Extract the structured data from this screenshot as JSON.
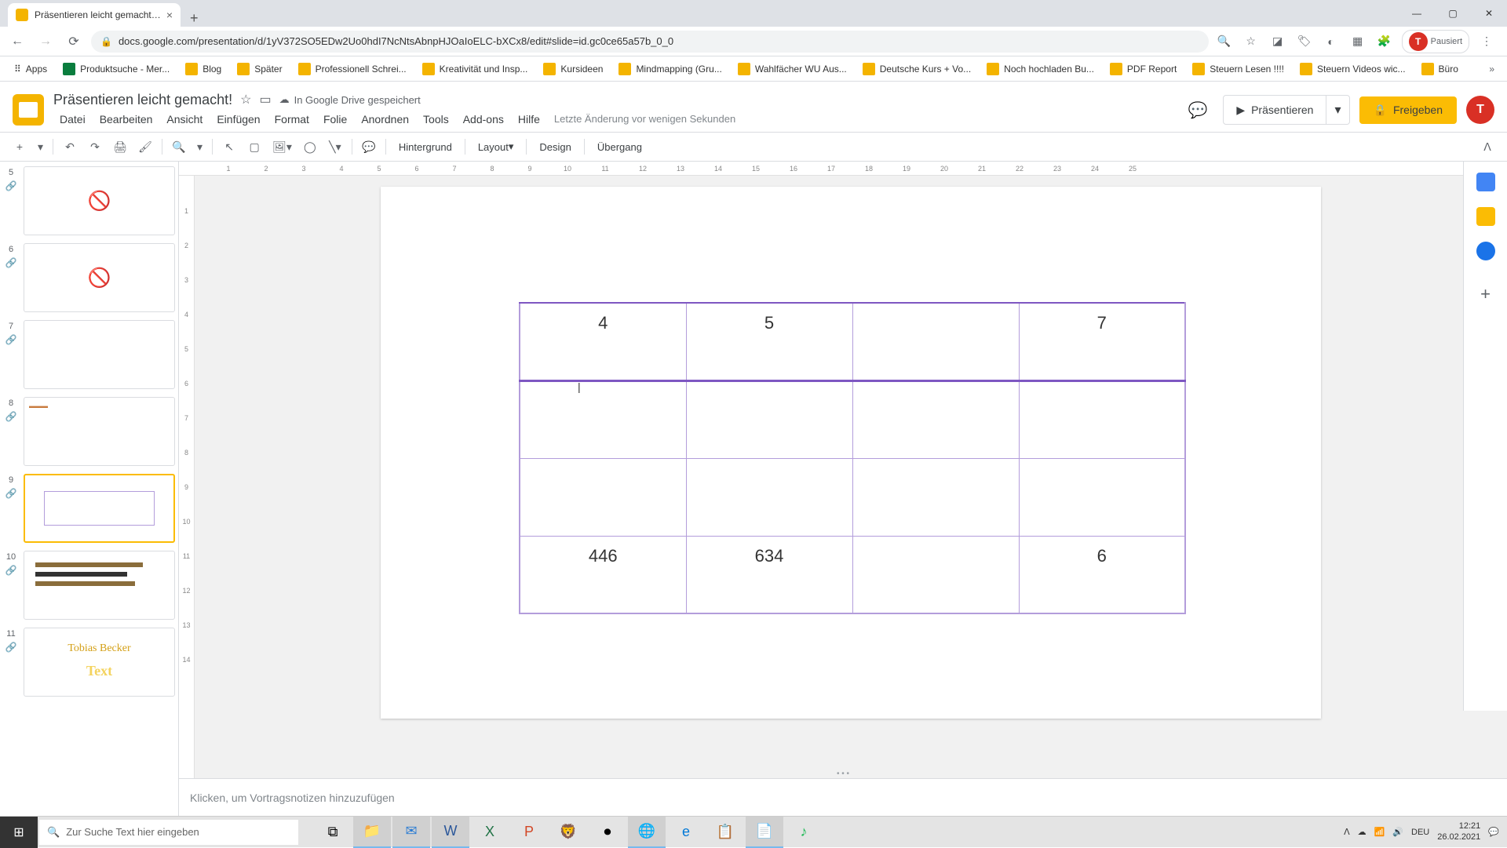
{
  "browser": {
    "tab_title": "Präsentieren leicht gemacht! - G",
    "url": "docs.google.com/presentation/d/1yV372SO5EDw2Uo0hdI7NcNtsAbnpHJOaIoELC-bXCx8/edit#slide=id.gc0ce65a57b_0_0",
    "pause_label": "Pausiert"
  },
  "bookmarks": [
    "Apps",
    "Produktsuche - Mer...",
    "Blog",
    "Später",
    "Professionell Schrei...",
    "Kreativität und Insp...",
    "Kursideen",
    "Mindmapping (Gru...",
    "Wahlfächer WU Aus...",
    "Deutsche Kurs + Vo...",
    "Noch hochladen Bu...",
    "PDF Report",
    "Steuern Lesen !!!!",
    "Steuern Videos wic...",
    "Büro"
  ],
  "app": {
    "title": "Präsentieren leicht gemacht!",
    "drive_status": "In Google Drive gespeichert",
    "last_edit": "Letzte Änderung vor wenigen Sekunden",
    "present": "Präsentieren",
    "share": "Freigeben",
    "avatar_initial": "T"
  },
  "menu": [
    "Datei",
    "Bearbeiten",
    "Ansicht",
    "Einfügen",
    "Format",
    "Folie",
    "Anordnen",
    "Tools",
    "Add-ons",
    "Hilfe"
  ],
  "toolbar": {
    "background": "Hintergrund",
    "layout": "Layout",
    "design": "Design",
    "transition": "Übergang"
  },
  "slides": [
    {
      "num": "5",
      "hidden": true
    },
    {
      "num": "6",
      "hidden": true
    },
    {
      "num": "7",
      "hidden": false,
      "blank": true
    },
    {
      "num": "8",
      "hidden": false
    },
    {
      "num": "9",
      "hidden": false,
      "selected": true
    },
    {
      "num": "10",
      "hidden": false
    },
    {
      "num": "11",
      "hidden": false
    }
  ],
  "table": {
    "rows": [
      [
        "4",
        "5",
        "",
        "7"
      ],
      [
        "",
        "",
        "",
        ""
      ],
      [
        "",
        "",
        "",
        ""
      ],
      [
        "446",
        "634",
        "",
        "6"
      ]
    ]
  },
  "ruler_h": [
    "1",
    "2",
    "3",
    "4",
    "5",
    "6",
    "7",
    "8",
    "9",
    "10",
    "11",
    "12",
    "13",
    "14",
    "15",
    "16",
    "17",
    "18",
    "19",
    "20",
    "21",
    "22",
    "23",
    "24",
    "25"
  ],
  "ruler_v": [
    "1",
    "2",
    "3",
    "4",
    "5",
    "6",
    "7",
    "8",
    "9",
    "10",
    "11",
    "12",
    "13",
    "14"
  ],
  "notes_placeholder": "Klicken, um Vortragsnotizen hinzuzufügen",
  "taskbar": {
    "search_placeholder": "Zur Suche Text hier eingeben",
    "lang": "DEU",
    "time": "12:21",
    "date": "26.02.2021"
  }
}
